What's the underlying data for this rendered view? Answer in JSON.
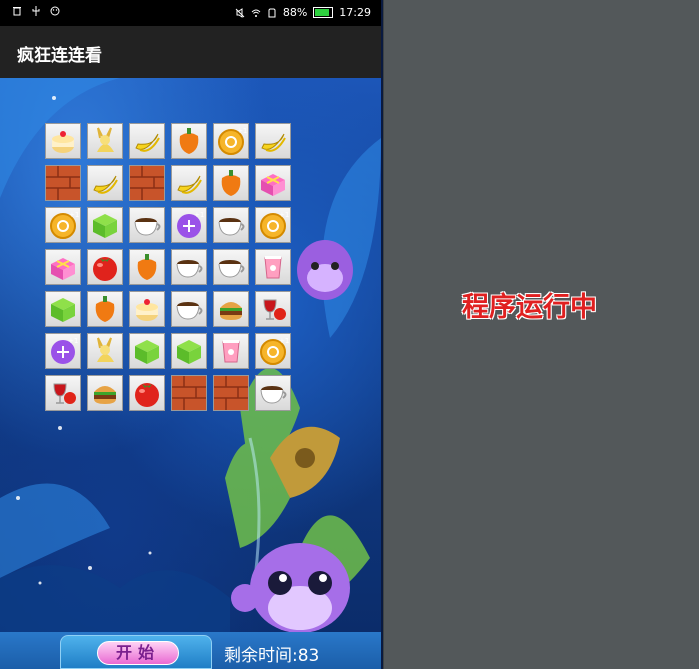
{
  "status_bar": {
    "battery": "88%",
    "time": "17:29"
  },
  "app": {
    "title": "疯狂连连看"
  },
  "board": {
    "columns": 6,
    "rows": [
      [
        "cake",
        "rabbit",
        "banana",
        "pepper",
        "coin",
        "banana"
      ],
      [
        "brick",
        "banana",
        "brick",
        "banana",
        "pepper",
        "gift"
      ],
      [
        "coin",
        "box",
        "coffee",
        "potion",
        "coffee",
        "coin"
      ],
      [
        "gift",
        "tomato",
        "pepper",
        "coffee",
        "coffee",
        "cup"
      ],
      [
        "box",
        "pepper",
        "cake",
        "coffee",
        "burger",
        "wine"
      ],
      [
        "potion",
        "rabbit",
        "box",
        "box",
        "cup",
        "coin"
      ],
      [
        "wine",
        "burger",
        "tomato",
        "brick",
        "brick",
        "coffee"
      ]
    ]
  },
  "bottom": {
    "start_label": "开始",
    "timer_text": "剩余时间:83"
  },
  "right_panel": {
    "label": "程序运行中"
  }
}
